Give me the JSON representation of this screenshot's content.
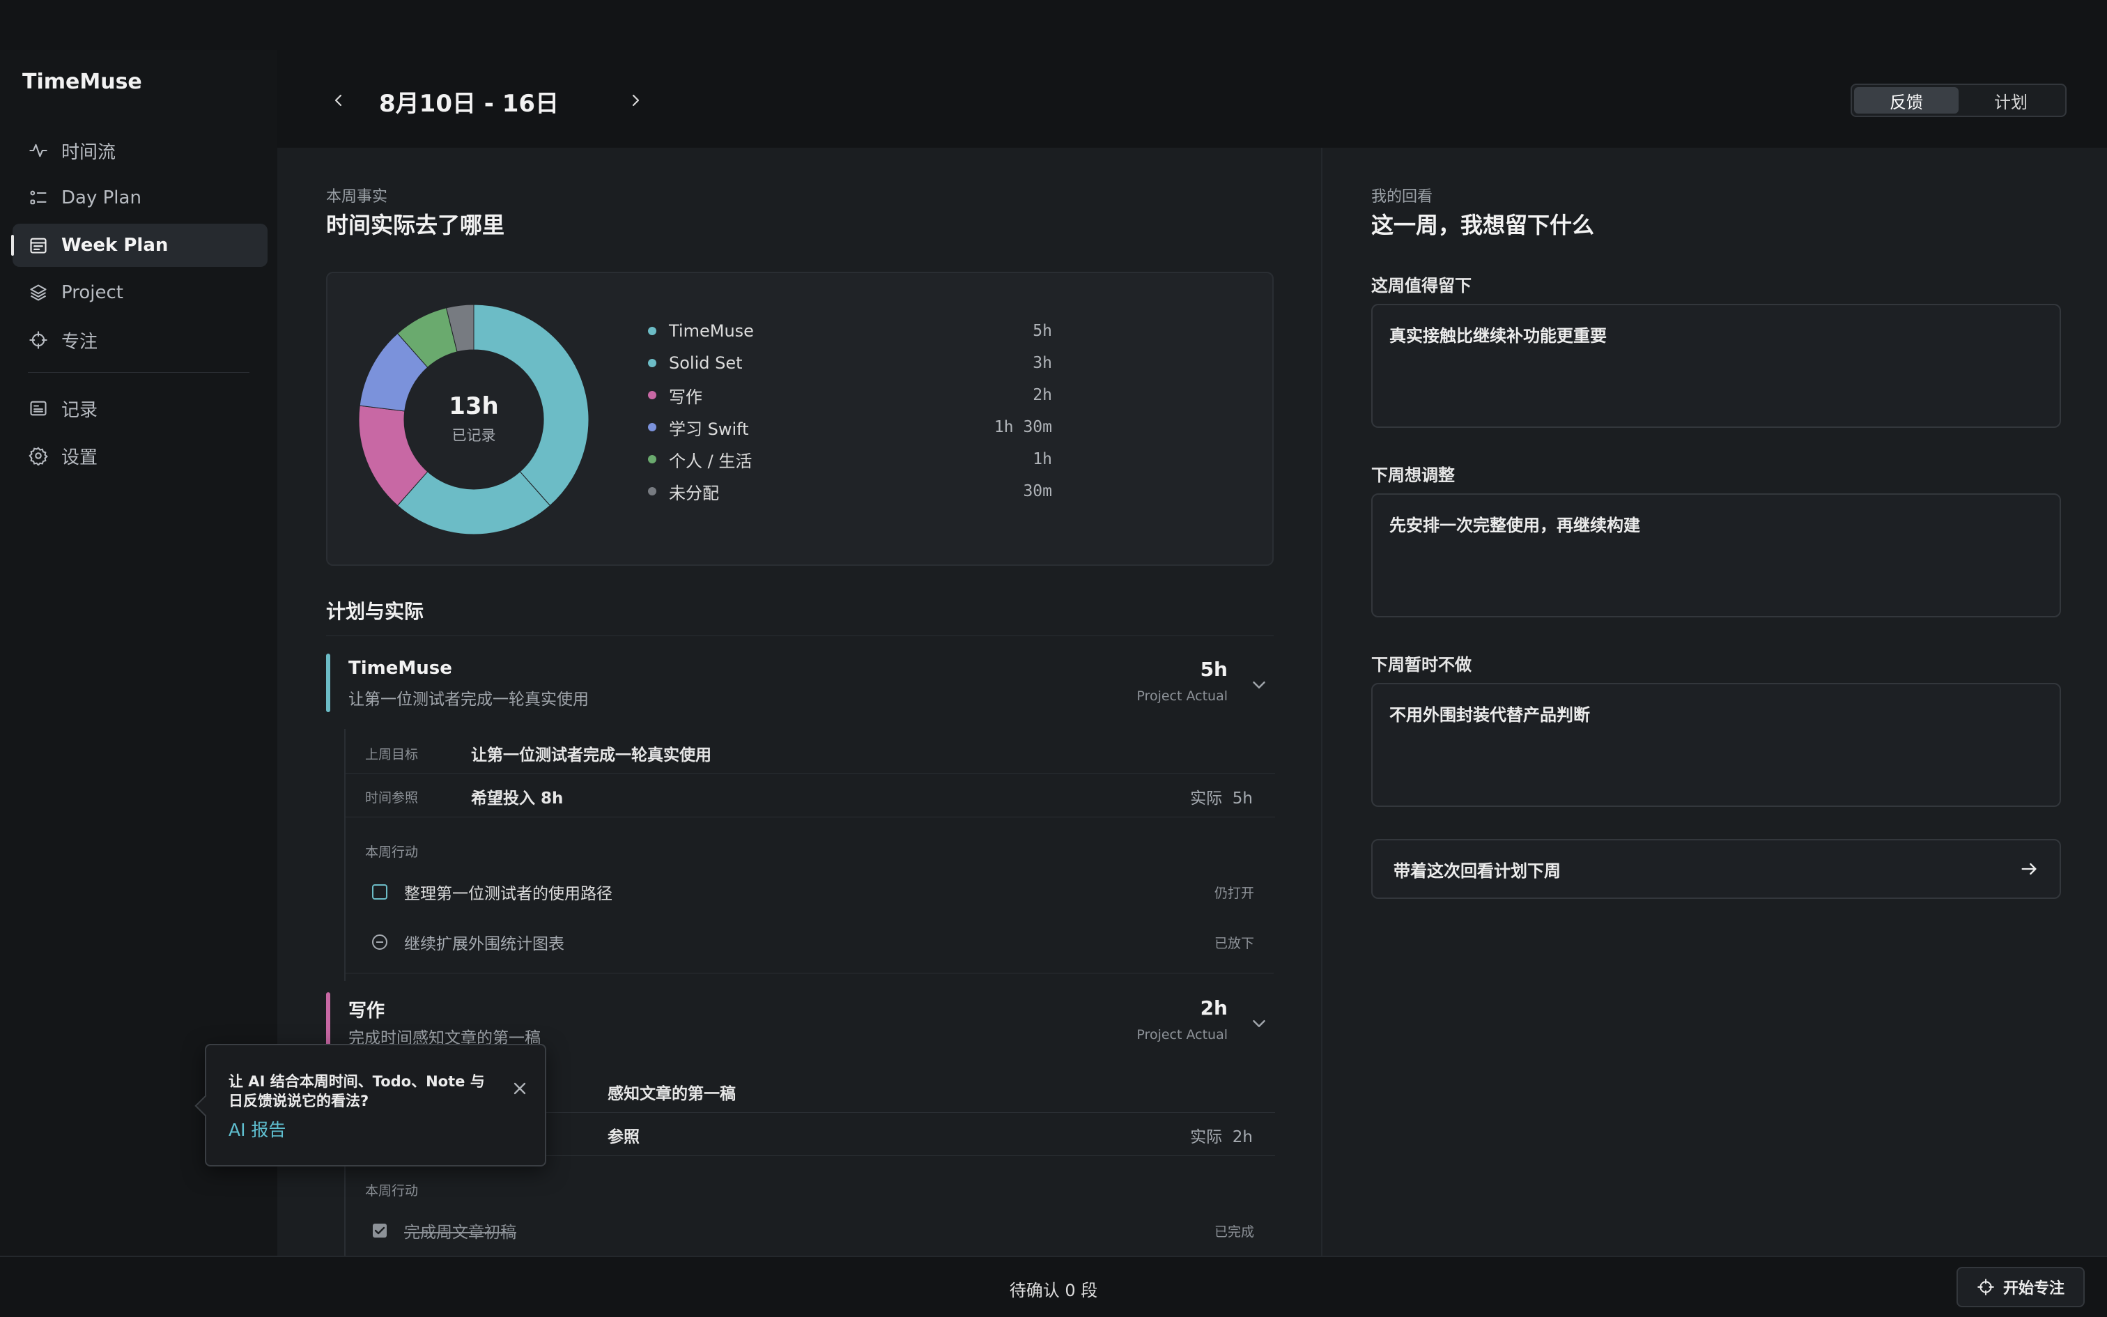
{
  "app": {
    "name": "TimeMuse"
  },
  "sidebar": {
    "items": [
      {
        "label": "时间流",
        "icon": "pulse-icon"
      },
      {
        "label": "Day Plan",
        "icon": "list-icon"
      },
      {
        "label": "Week Plan",
        "icon": "calendar-icon",
        "active": true
      },
      {
        "label": "Project",
        "icon": "layers-icon"
      },
      {
        "label": "专注",
        "icon": "crosshair-icon"
      },
      {
        "label": "记录",
        "icon": "notes-icon"
      },
      {
        "label": "设置",
        "icon": "gear-icon"
      }
    ]
  },
  "header": {
    "week_range": "8月10日 - 16日",
    "modes": [
      "反馈",
      "计划"
    ],
    "active_mode": "反馈"
  },
  "facts": {
    "kicker": "本周事实",
    "title": "时间实际去了哪里",
    "total": "13h",
    "total_label": "已记录",
    "legend": [
      {
        "name": "TimeMuse",
        "hours": "5h",
        "value": 5,
        "color": "#6cbcc6"
      },
      {
        "name": "Solid Set",
        "hours": "3h",
        "value": 3,
        "color": "#6cbcc6"
      },
      {
        "name": "写作",
        "hours": "2h",
        "value": 2,
        "color": "#c868a4"
      },
      {
        "name": "学习 Swift",
        "hours": "1h 30m",
        "value": 1.5,
        "color": "#7b92db"
      },
      {
        "name": "个人 / 生活",
        "hours": "1h",
        "value": 1,
        "color": "#6aaa6e"
      },
      {
        "name": "未分配",
        "hours": "30m",
        "value": 0.5,
        "color": "#777b81"
      }
    ]
  },
  "plan_vs_actual": {
    "title": "计划与实际",
    "projects": [
      {
        "name": "TimeMuse",
        "goal": "让第一位测试者完成一轮真实使用",
        "hours": "5h",
        "actual_label": "Project Actual",
        "color": "#6cbcc6",
        "last_goal_label": "上周目标",
        "last_goal": "让第一位测试者完成一轮真实使用",
        "time_ref_label": "时间参照",
        "time_ref": "希望投入 8h",
        "actual_prefix": "实际",
        "actual_value": "5h",
        "actions_label": "本周行动",
        "actions": [
          {
            "text": "整理第一位测试者的使用路径",
            "status": "仍打开"
          },
          {
            "text": "继续扩展外围统计图表",
            "status": "已放下"
          }
        ]
      },
      {
        "name": "写作",
        "goal": "完成时间感知文章的第一稿",
        "hours": "2h",
        "actual_label": "Project Actual",
        "color": "#c868a4",
        "last_goal_partial": "感知文章的第一稿",
        "time_ref_partial": "参照",
        "actual_prefix": "实际",
        "actual_value": "2h",
        "actions_label": "本周行动",
        "actions": [
          {
            "text": "完成周文章初稿",
            "status": "已完成"
          }
        ]
      }
    ]
  },
  "review": {
    "kicker": "我的回看",
    "title": "这一周，我想留下什么",
    "fields": [
      {
        "label": "这周值得留下",
        "value": "真实接触比继续补功能更重要"
      },
      {
        "label": "下周想调整",
        "value": "先安排一次完整使用，再继续构建"
      },
      {
        "label": "下周暂时不做",
        "value": "不用外围封装代替产品判断"
      }
    ],
    "cta": "带着这次回看计划下周"
  },
  "ai_popover": {
    "text": "让 AI 结合本周时间、Todo、Note 与日反馈说说它的看法?",
    "link": "AI 报告"
  },
  "footer": {
    "status": "待确认 0 段",
    "focus_button": "开始专注"
  }
}
